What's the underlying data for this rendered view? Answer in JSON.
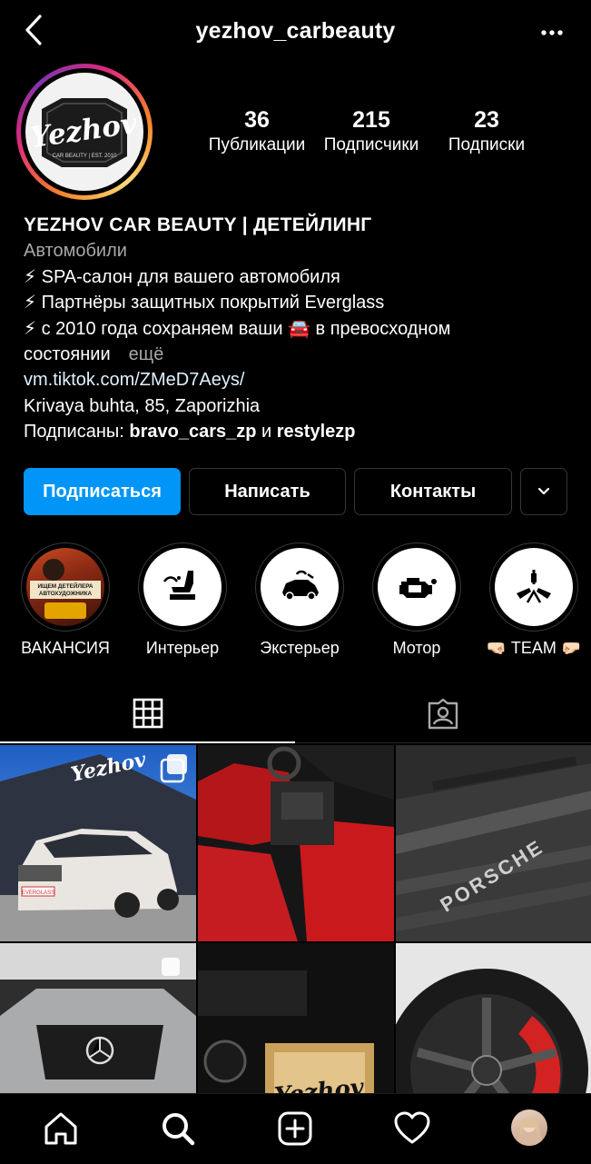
{
  "header": {
    "title": "yezhov_carbeauty"
  },
  "profile": {
    "stats": [
      {
        "value": "36",
        "label": "Публикации"
      },
      {
        "value": "215",
        "label": "Подписчики"
      },
      {
        "value": "23",
        "label": "Подписки"
      }
    ],
    "avatar_text": "Yezhov",
    "avatar_subtext": "CAR BEAUTY | EST. 2010"
  },
  "bio": {
    "name": "YEZHOV CAR BEAUTY | ДЕТЕЙЛИНГ",
    "category": "Автомобили",
    "line1": "⚡ SPA-салон для вашего автомобиля",
    "line2": "⚡ Партнёры защитных покрытий Everglass",
    "line3": "⚡ с 2010 года сохраняем ваши 🚘 в превосходном",
    "line4": "состоянии",
    "more": "ещё",
    "link": "vm.tiktok.com/ZMeD7Aeys/",
    "address": "Krivaya buhta, 85, Zaporizhia",
    "followed_prefix": "Подписаны: ",
    "followed_user1": "bravo_cars_zp",
    "followed_and": " и ",
    "followed_user2": "restylezp"
  },
  "buttons": {
    "follow": "Подписаться",
    "message": "Написать",
    "contacts": "Контакты"
  },
  "highlights": [
    {
      "label": "ВАКАНСИЯ",
      "cover_text1": "ИЩЕМ ДЕТЕЙЛЕРА",
      "cover_text2": "АВТОХУДОЖНИКА"
    },
    {
      "label": "Интерьер"
    },
    {
      "label": "Экстерьер"
    },
    {
      "label": "Мотор"
    },
    {
      "label": "🤜🏻 TEAM 🤛🏻"
    }
  ],
  "grid": {
    "post1_logo": "Yezhov",
    "post1_plate": "EVERGLASS",
    "post3_text": "PORSCHE",
    "post5_logo": "Yezhov"
  },
  "colors": {
    "accent": "#0095f6",
    "background": "#000000",
    "secondary_text": "#a8a8a8",
    "border": "#363636"
  }
}
